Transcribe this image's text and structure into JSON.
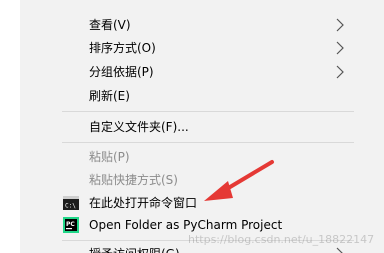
{
  "context_menu": {
    "items": [
      {
        "label": "查看(V)"
      },
      {
        "label": "排序方式(O)"
      },
      {
        "label": "分组依据(P)"
      },
      {
        "label": "刷新(E)"
      },
      {
        "label": "自定义文件夹(F)..."
      },
      {
        "label": "粘贴(P)"
      },
      {
        "label": "粘贴快捷方式(S)"
      },
      {
        "label": "在此处打开命令窗口"
      },
      {
        "label": "Open Folder as PyCharm Project"
      },
      {
        "label": "授予访问权限(G)"
      }
    ]
  },
  "annotation": {
    "arrow_color": "#e53935"
  },
  "watermark": {
    "text": "https://blog.csdn.net/u_18822147"
  }
}
